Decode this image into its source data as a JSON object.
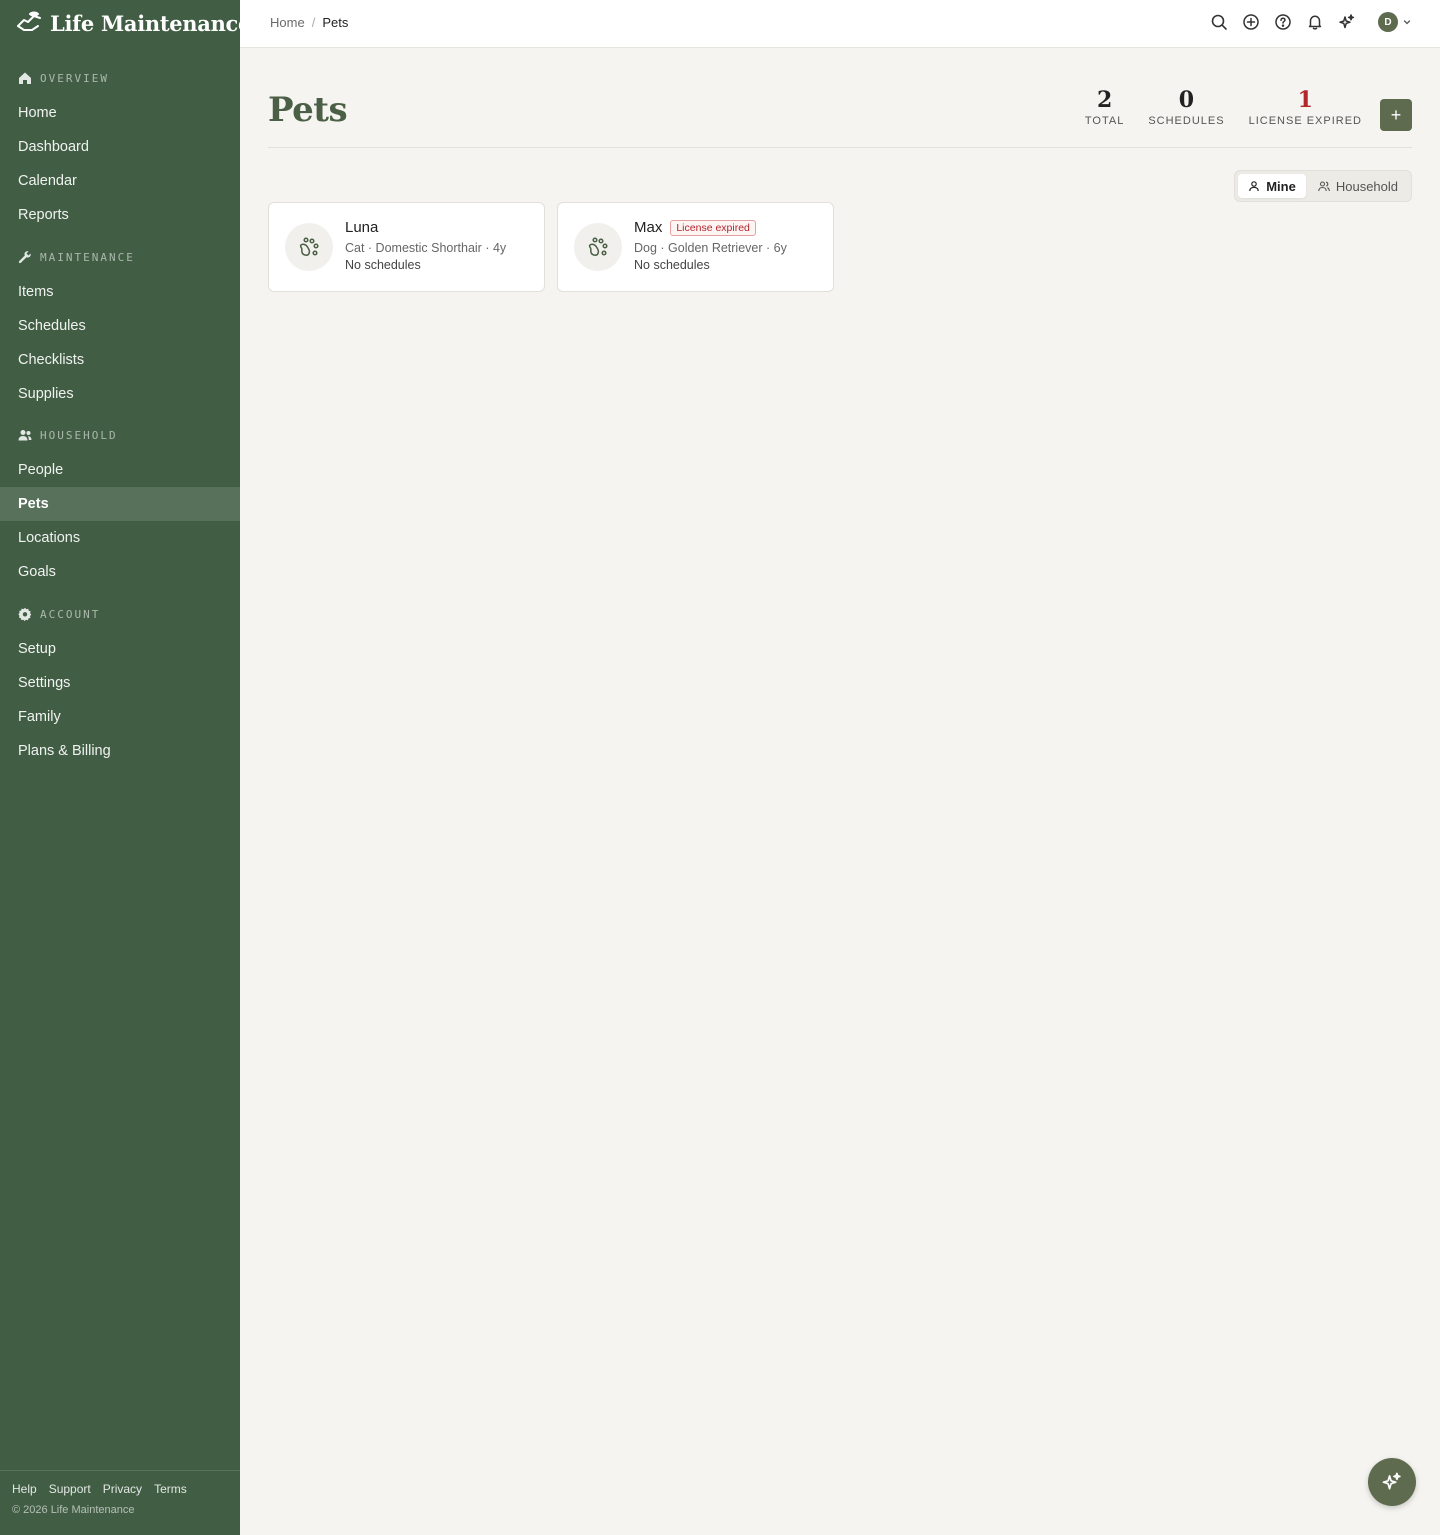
{
  "app": {
    "name": "Life Maintenance"
  },
  "sidebar": {
    "sections": [
      {
        "heading": "Overview",
        "icon": "home-icon",
        "items": [
          "Home",
          "Dashboard",
          "Calendar",
          "Reports"
        ]
      },
      {
        "heading": "Maintenance",
        "icon": "wrench-icon",
        "items": [
          "Items",
          "Schedules",
          "Checklists",
          "Supplies"
        ]
      },
      {
        "heading": "Household",
        "icon": "people-icon",
        "items": [
          "People",
          "Pets",
          "Locations",
          "Goals"
        ]
      },
      {
        "heading": "Account",
        "icon": "gear-icon",
        "items": [
          "Setup",
          "Settings",
          "Family",
          "Plans & Billing"
        ]
      }
    ],
    "active_item": "Pets",
    "footer": {
      "links": [
        "Help",
        "Support",
        "Privacy",
        "Terms"
      ],
      "copyright": "© 2026 Life Maintenance"
    }
  },
  "topbar": {
    "breadcrumb": [
      "Home",
      "Pets"
    ],
    "icons": [
      "search-icon",
      "plus-circle-icon",
      "help-icon",
      "bell-icon",
      "sparkle-icon"
    ],
    "avatar_initial": "D"
  },
  "page": {
    "title": "Pets",
    "stats": [
      {
        "value": "2",
        "label": "Total"
      },
      {
        "value": "0",
        "label": "Schedules"
      },
      {
        "value": "1",
        "label": "License expired",
        "color": "#b3262b"
      }
    ],
    "add_label": "+",
    "toggle": {
      "options": [
        "Mine",
        "Household"
      ],
      "selected": "Mine"
    },
    "pets": [
      {
        "name": "Luna",
        "meta": "Cat · Domestic Shorthair · 4y",
        "schedules": "No schedules",
        "badge": ""
      },
      {
        "name": "Max",
        "meta": "Dog · Golden Retriever · 6y",
        "schedules": "No schedules",
        "badge": "License expired"
      }
    ]
  },
  "colors": {
    "sidebar": "#415e45",
    "accent": "#5e6b4f",
    "danger": "#b3262b",
    "background": "#f5f4f0"
  }
}
